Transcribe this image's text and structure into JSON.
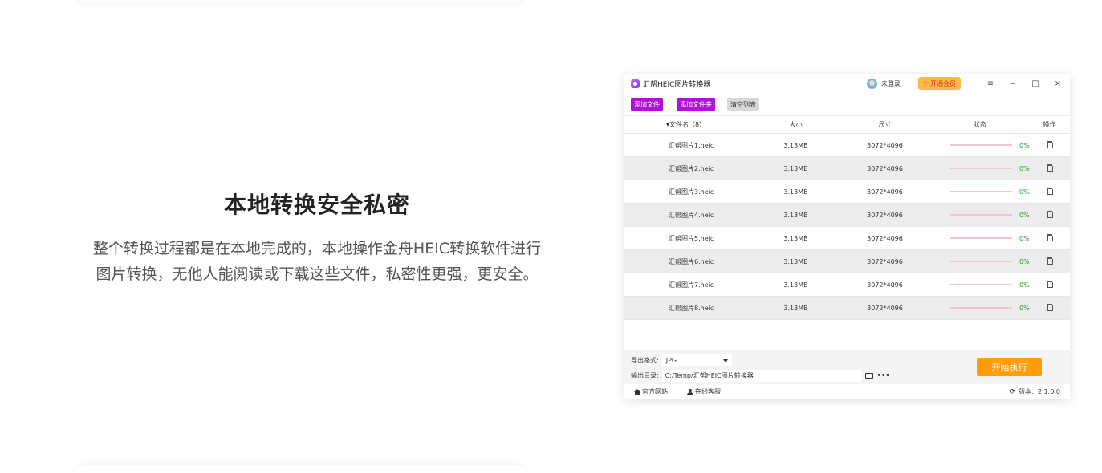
{
  "feature": {
    "heading": "本地转换安全私密",
    "desc_line1": "整个转换过程都是在本地完成的，本地操作金舟HEIC转换软件进行",
    "desc_line2": "图片转换，无他人能阅读或下载这些文件，私密性更强，更安全。"
  },
  "app": {
    "title": "汇帮HEIC图片转换器",
    "login_label": "未登录",
    "vip_label": "开通会员",
    "window_controls": {
      "menu": "≡",
      "minimize": "–",
      "maximize": "□",
      "close": "×"
    },
    "toolbar": {
      "add_file": "添加文件",
      "add_folder": "添加文件夹",
      "clear_list": "清空列表"
    },
    "table": {
      "headers": {
        "name": "▾文件名（8）",
        "size": "大小",
        "dimension": "尺寸",
        "status": "状态",
        "op": "操作"
      },
      "rows": [
        {
          "name": "汇帮图片1.heic",
          "size": "3.13MB",
          "dim": "3072*4096",
          "progress": 0,
          "pct": "0%"
        },
        {
          "name": "汇帮图片2.heic",
          "size": "3.13MB",
          "dim": "3072*4096",
          "progress": 0,
          "pct": "0%"
        },
        {
          "name": "汇帮图片3.heic",
          "size": "3.13MB",
          "dim": "3072*4096",
          "progress": 0,
          "pct": "0%"
        },
        {
          "name": "汇帮图片4.heic",
          "size": "3.13MB",
          "dim": "3072*4096",
          "progress": 0,
          "pct": "0%"
        },
        {
          "name": "汇帮图片5.heic",
          "size": "3.13MB",
          "dim": "3072*4096",
          "progress": 0,
          "pct": "0%"
        },
        {
          "name": "汇帮图片6.heic",
          "size": "3.13MB",
          "dim": "3072*4096",
          "progress": 0,
          "pct": "0%"
        },
        {
          "name": "汇帮图片7.heic",
          "size": "3.13MB",
          "dim": "3072*4096",
          "progress": 0,
          "pct": "0%"
        },
        {
          "name": "汇帮图片8.heic",
          "size": "3.13MB",
          "dim": "3072*4096",
          "progress": 0,
          "pct": "0%"
        }
      ]
    },
    "export": {
      "format_label": "导出格式:",
      "format_value": "JPG",
      "output_label": "输出目录:",
      "output_path": "C:/Temp/汇帮HEIC图片转换器",
      "more": "•••",
      "start_button": "开始执行"
    },
    "footer": {
      "website": "官方网站",
      "support": "在线客服",
      "version": "版本：2.1.0.0"
    },
    "colors": {
      "accent_purple": "#b20fd9",
      "start_orange": "#ff9d0c",
      "vip_yellow": "#ffb94a",
      "pct_green": "#2aa42a"
    }
  }
}
